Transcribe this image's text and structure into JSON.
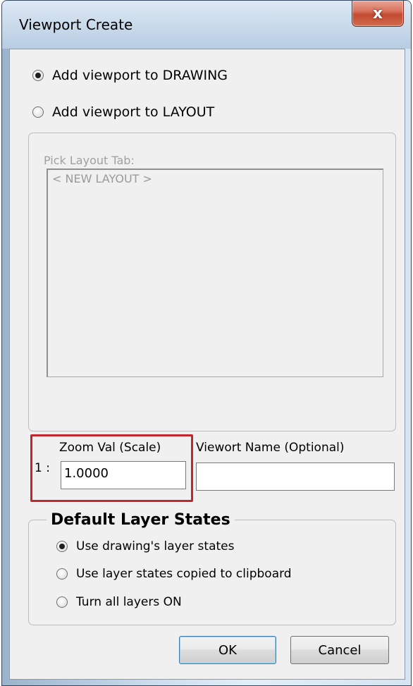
{
  "window": {
    "title": "Viewport Create",
    "close_label": "x"
  },
  "target": {
    "options": [
      {
        "label": "Add viewport to DRAWING",
        "checked": true
      },
      {
        "label": "Add viewport to LAYOUT",
        "checked": false
      }
    ]
  },
  "layout_picker": {
    "caption": "Pick Layout Tab:",
    "items": [
      "< NEW LAYOUT >"
    ]
  },
  "zoom": {
    "label": "Zoom Val (Scale)",
    "prefix": "1 :",
    "value": "1.0000"
  },
  "viewport_name": {
    "label": "Viewort Name (Optional)",
    "value": ""
  },
  "layer_states": {
    "title": "Default Layer States",
    "options": [
      {
        "label": "Use drawing's layer states",
        "checked": true
      },
      {
        "label": "Use layer states copied to clipboard",
        "checked": false
      },
      {
        "label": "Turn all layers ON",
        "checked": false
      }
    ]
  },
  "buttons": {
    "ok": "OK",
    "cancel": "Cancel"
  },
  "colors": {
    "highlight": "#c0282b",
    "close_button": "#c24a30"
  }
}
